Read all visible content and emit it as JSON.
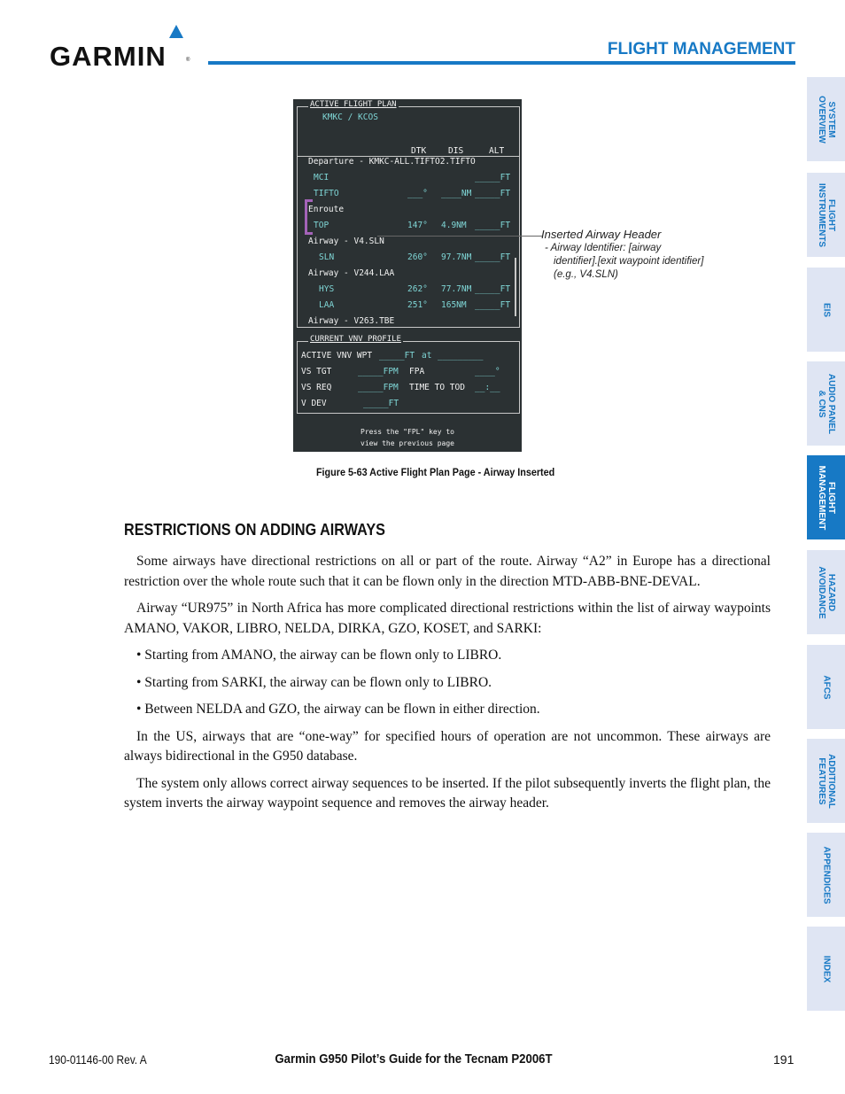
{
  "header": {
    "logo": "GARMIN",
    "section_title": "FLIGHT MANAGEMENT",
    "accent_color": "#1779c5"
  },
  "figure": {
    "screen": {
      "fpl_title": "ACTIVE FLIGHT PLAN",
      "route": "KMKC / KCOS",
      "columns": [
        "DTK",
        "DIS",
        "ALT"
      ],
      "rows": [
        {
          "type": "header",
          "text": "Departure - KMKC-ALL.TIFTO2.TIFTO"
        },
        {
          "type": "wpt",
          "name": "MCI",
          "dtk": "",
          "dis": "",
          "alt": "_____FT"
        },
        {
          "type": "wpt",
          "name": "TIFTO",
          "dtk": "___°",
          "dis": "____NM",
          "alt": "_____FT"
        },
        {
          "type": "header",
          "text": "Enroute"
        },
        {
          "type": "wpt",
          "name": "TOP",
          "dtk": "147°",
          "dis": "4.9NM",
          "alt": "_____FT"
        },
        {
          "type": "header",
          "text": "Airway - V4.SLN"
        },
        {
          "type": "wpt",
          "name": "SLN",
          "dtk": "260°",
          "dis": "97.7NM",
          "alt": "_____FT"
        },
        {
          "type": "header",
          "text": "Airway - V244.LAA"
        },
        {
          "type": "wpt",
          "name": "HYS",
          "dtk": "262°",
          "dis": "77.7NM",
          "alt": "_____FT"
        },
        {
          "type": "wpt",
          "name": "LAA",
          "dtk": "251°",
          "dis": "165NM",
          "alt": "_____FT"
        },
        {
          "type": "header",
          "text": "Airway - V263.TBE"
        }
      ],
      "vnv_title": "CURRENT VNV PROFILE",
      "vnv": {
        "active_label": "ACTIVE VNV WPT",
        "active_value": "_____FT",
        "at": "at",
        "active_wpt": "_________",
        "vs_tgt_label": "VS TGT",
        "vs_tgt_value": "_____FPM",
        "fpa_label": "FPA",
        "fpa_value": "____°",
        "vs_req_label": "VS REQ",
        "vs_req_value": "_____FPM",
        "tod_label": "TIME TO TOD",
        "tod_value": "__:__",
        "vdev_label": "V DEV",
        "vdev_value": "_____FT"
      },
      "prompt_line1": "Press the \"FPL\" key to",
      "prompt_line2": "view the previous page"
    },
    "callout": {
      "title": "Inserted Airway Header",
      "line1": "- Airway Identifier: [airway",
      "line2": "identifier].[exit waypoint identifier]",
      "line3": "(e.g., V4.SLN)"
    },
    "caption": "Figure 5-63  Active Flight Plan Page - Airway Inserted"
  },
  "section": {
    "heading": "RESTRICTIONS ON ADDING AIRWAYS",
    "paragraphs": [
      "Some airways have directional restrictions on all or part of the route.  Airway “A2” in Europe has a directional restriction over the whole route such that it can be flown only in the direction MTD-ABB-BNE-DEVAL.",
      "Airway “UR975” in North Africa has more complicated directional restrictions within the list of airway waypoints AMANO, VAKOR, LIBRO, NELDA, DIRKA, GZO, KOSET, and SARKI:"
    ],
    "bullets": [
      "• Starting from AMANO, the airway can be flown only to LIBRO.",
      "• Starting from SARKI, the airway can be flown only to LIBRO.",
      "• Between NELDA and GZO, the airway can be flown in either direction."
    ],
    "paragraphs_after": [
      "In the US, airways that are “one-way” for specified hours of operation are not uncommon.  These airways are always bidirectional in the G950 database.",
      "The system only allows correct airway sequences to be inserted.  If the pilot subsequently inverts the flight plan, the system inverts the airway waypoint sequence and removes the airway header."
    ]
  },
  "side_tabs": [
    {
      "label": "SYSTEM\nOVERVIEW",
      "active": false
    },
    {
      "label": "FLIGHT\nINSTRUMENTS",
      "active": false
    },
    {
      "label": "EIS",
      "active": false
    },
    {
      "label": "AUDIO PANEL\n& CNS",
      "active": false
    },
    {
      "label": "FLIGHT\nMANAGEMENT",
      "active": true
    },
    {
      "label": "HAZARD\nAVOIDANCE",
      "active": false
    },
    {
      "label": "AFCS",
      "active": false
    },
    {
      "label": "ADDITIONAL\nFEATURES",
      "active": false
    },
    {
      "label": "APPENDICES",
      "active": false
    },
    {
      "label": "INDEX",
      "active": false
    }
  ],
  "footer": {
    "doc_number": "190-01146-00  Rev. A",
    "title": "Garmin G950 Pilot’s Guide for the Tecnam P2006T",
    "page": "191"
  }
}
